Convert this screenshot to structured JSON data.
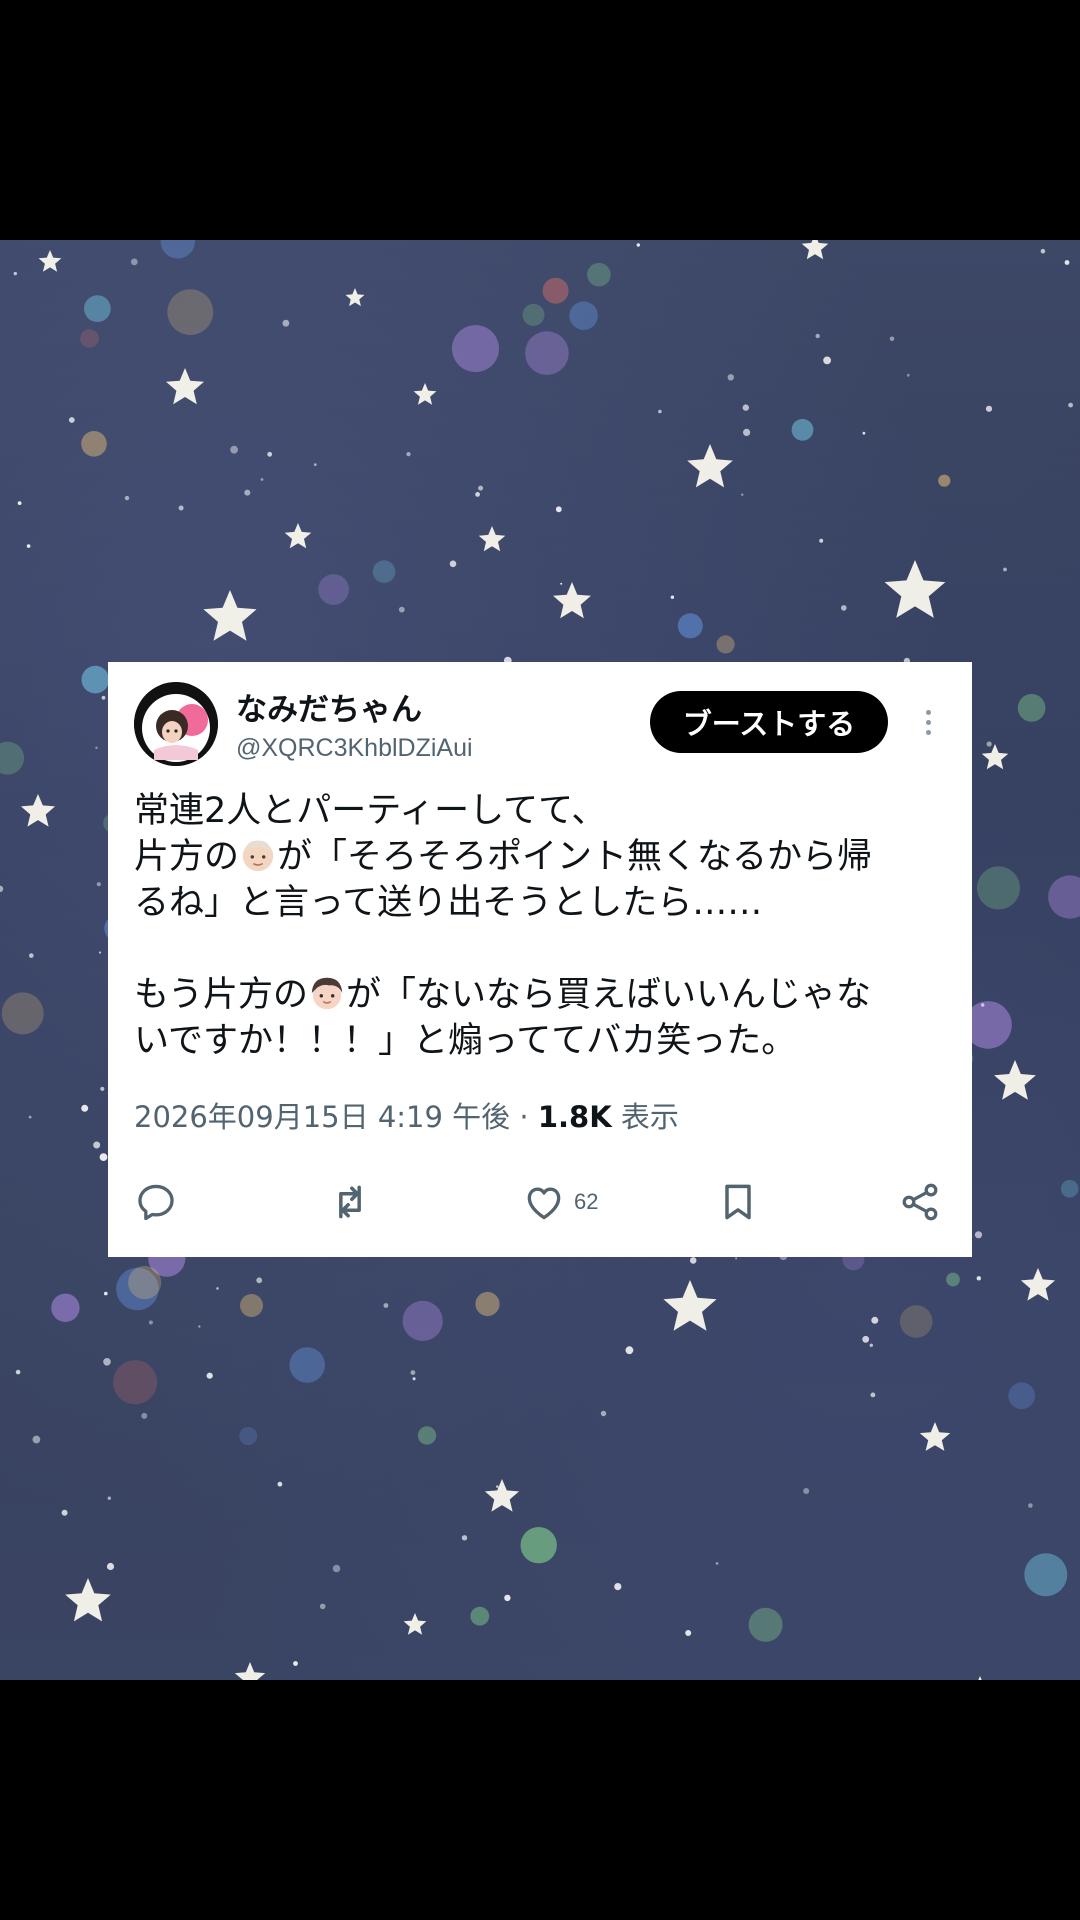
{
  "post": {
    "display_name": "なみだちゃん",
    "handle": "@XQRC3KhblDZiAui",
    "boost_label": "ブーストする",
    "text": {
      "line1": "常連2人とパーティーしてて、",
      "line2_a": "片方の",
      "line2_b": "が「そろそろポイント無くなるから帰",
      "line3": "るね」と言って送り出そうとしたら……",
      "line4_a": "もう片方の",
      "line4_b": "が「ないなら買えばいいんじゃな",
      "line5": "いですか！！！」と煽っててバカ笑った。"
    },
    "timestamp": "2026年09月15日 4:19 午後",
    "separator": "·",
    "views_count": "1.8K",
    "views_label": "表示",
    "likes_count": "62"
  },
  "icons": {
    "reply": "reply-icon",
    "repost": "repost-icon",
    "like": "heart-icon",
    "bookmark": "bookmark-icon",
    "share": "share-icon",
    "more": "more-vertical-icon"
  },
  "colors": {
    "background_top": "#3d4766",
    "card": "#ffffff",
    "text": "#0f1419",
    "muted": "#536471",
    "button": "#000000"
  }
}
